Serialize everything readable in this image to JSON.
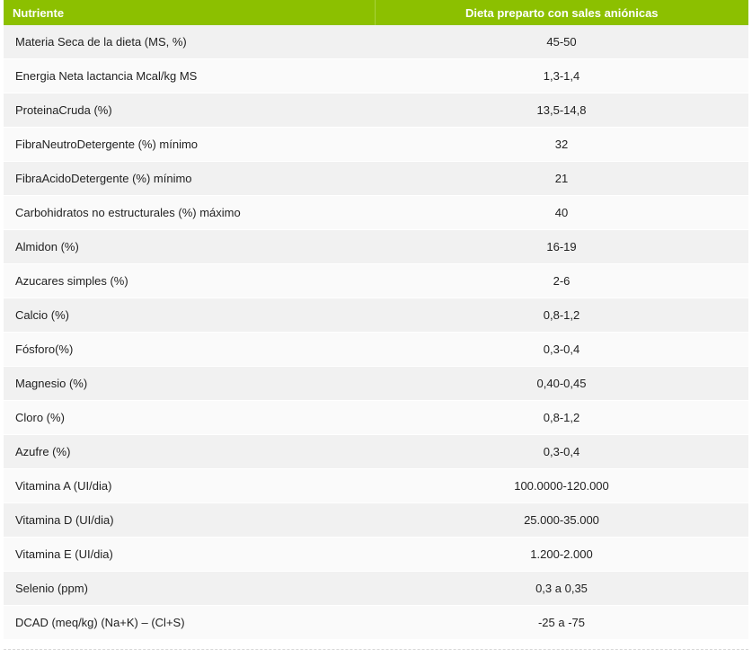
{
  "table": {
    "headers": [
      "Nutriente",
      "Dieta preparto con sales aniónicas"
    ],
    "rows": [
      [
        "Materia Seca de la dieta (MS, %)",
        "45-50"
      ],
      [
        "Energia Neta lactancia Mcal/kg MS",
        "1,3-1,4"
      ],
      [
        "ProteinaCruda (%)",
        "13,5-14,8"
      ],
      [
        "FibraNeutroDetergente (%) mínimo",
        "32"
      ],
      [
        "FibraAcidoDetergente (%) mínimo",
        "21"
      ],
      [
        "Carbohidratos no estructurales (%) máximo",
        "40"
      ],
      [
        "Almidon (%)",
        "16-19"
      ],
      [
        "Azucares simples (%)",
        "2-6"
      ],
      [
        "Calcio (%)",
        "0,8-1,2"
      ],
      [
        "Fósforo(%)",
        "0,3-0,4"
      ],
      [
        "Magnesio (%)",
        "0,40-0,45"
      ],
      [
        "Cloro (%)",
        "0,8-1,2"
      ],
      [
        "Azufre (%)",
        "0,3-0,4"
      ],
      [
        "Vitamina A (UI/dia)",
        "100.0000-120.000"
      ],
      [
        "Vitamina D (UI/dia)",
        "25.000-35.000"
      ],
      [
        "Vitamina E (UI/dia)",
        "1.200-2.000"
      ],
      [
        "Selenio (ppm)",
        "0,3 a 0,35"
      ],
      [
        "DCAD (meq/kg) (Na+K) – (Cl+S)",
        "-25 a -75"
      ]
    ]
  },
  "colors": {
    "header_bg": "#8cc000",
    "header_text": "#ffffff",
    "row_odd": "#f1f1f1",
    "row_even": "#fafafa"
  }
}
